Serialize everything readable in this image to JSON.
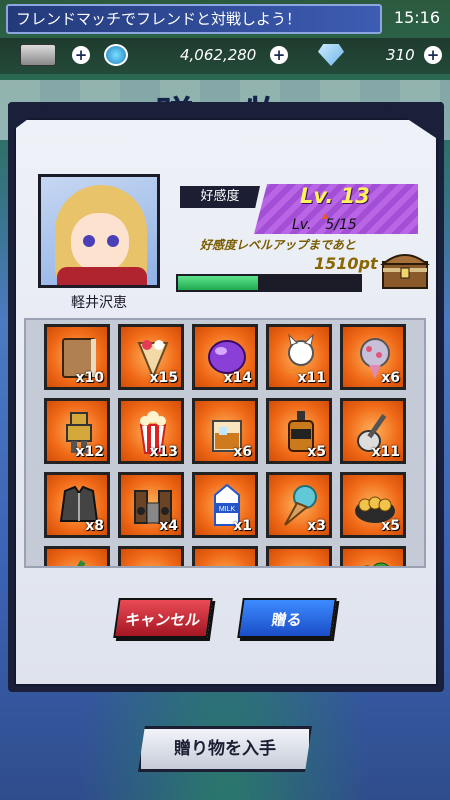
{
  "status": {
    "ticker": "フレンドマッチでフレンドと対戦しよう！",
    "time": "15:16"
  },
  "resources": {
    "coins": "4,062,280",
    "gems": "310",
    "plus_label": "+"
  },
  "banner": {
    "title": "贈 物"
  },
  "character": {
    "name": "軽井沢恵",
    "affinity_label": "好感度",
    "level_main": "Lv. 13",
    "level_sub": "Lv.　5/15",
    "next_level_text": "好感度レベルアップまであと",
    "points_remaining": "1510pt",
    "progress_fraction": 0.44
  },
  "items": [
    {
      "icon": "book-icon",
      "count": "x10"
    },
    {
      "icon": "crepe-icon",
      "count": "x15"
    },
    {
      "icon": "gem-icon",
      "count": "x14"
    },
    {
      "icon": "fox-plush-icon",
      "count": "x11"
    },
    {
      "icon": "bouquet-icon",
      "count": "x6"
    },
    {
      "icon": "robot-figure-icon",
      "count": "x12"
    },
    {
      "icon": "popcorn-icon",
      "count": "x13"
    },
    {
      "icon": "whiskey-glass-icon",
      "count": "x6"
    },
    {
      "icon": "liquor-bottle-icon",
      "count": "x5"
    },
    {
      "icon": "guitar-icon",
      "count": "x11"
    },
    {
      "icon": "jacket-icon",
      "count": "x8"
    },
    {
      "icon": "speakers-icon",
      "count": "x4"
    },
    {
      "icon": "milk-carton-icon",
      "count": "x1"
    },
    {
      "icon": "ice-cream-icon",
      "count": "x3"
    },
    {
      "icon": "takoyaki-icon",
      "count": "x5"
    },
    {
      "icon": "sake-bottle-icon",
      "count": ""
    },
    {
      "icon": "cake-icon",
      "count": ""
    },
    {
      "icon": "dumplings-icon",
      "count": ""
    },
    {
      "icon": "pastries-icon",
      "count": ""
    },
    {
      "icon": "broccoli-icon",
      "count": ""
    }
  ],
  "buttons": {
    "cancel": "キャンセル",
    "give": "贈る",
    "get_gifts": "贈り物を入手"
  },
  "colors": {
    "accent_purple": "#a24fd6",
    "cancel_red": "#c62632",
    "give_blue": "#2864e0",
    "tile_orange": "#f06a18"
  }
}
